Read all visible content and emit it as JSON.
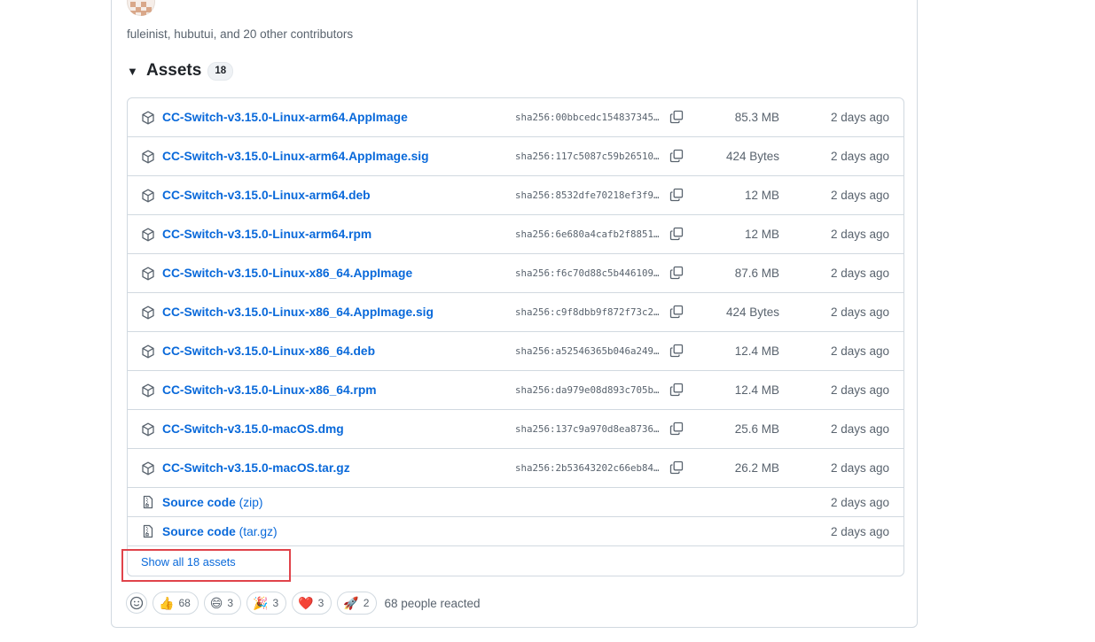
{
  "release": {
    "contributors_text": "fuleinist, hubutui, and 20 other contributors"
  },
  "assets": {
    "title": "Assets",
    "count": "18",
    "files": [
      {
        "name": "CC-Switch-v3.15.0-Linux-arm64.AppImage",
        "sha": "sha256:00bbcedc154837345…",
        "size": "85.3 MB",
        "date": "2 days ago"
      },
      {
        "name": "CC-Switch-v3.15.0-Linux-arm64.AppImage.sig",
        "sha": "sha256:117c5087c59b26510…",
        "size": "424 Bytes",
        "date": "2 days ago"
      },
      {
        "name": "CC-Switch-v3.15.0-Linux-arm64.deb",
        "sha": "sha256:8532dfe70218ef3f9…",
        "size": "12 MB",
        "date": "2 days ago"
      },
      {
        "name": "CC-Switch-v3.15.0-Linux-arm64.rpm",
        "sha": "sha256:6e680a4cafb2f8851…",
        "size": "12 MB",
        "date": "2 days ago"
      },
      {
        "name": "CC-Switch-v3.15.0-Linux-x86_64.AppImage",
        "sha": "sha256:f6c70d88c5b446109…",
        "size": "87.6 MB",
        "date": "2 days ago"
      },
      {
        "name": "CC-Switch-v3.15.0-Linux-x86_64.AppImage.sig",
        "sha": "sha256:c9f8dbb9f872f73c2…",
        "size": "424 Bytes",
        "date": "2 days ago"
      },
      {
        "name": "CC-Switch-v3.15.0-Linux-x86_64.deb",
        "sha": "sha256:a52546365b046a249…",
        "size": "12.4 MB",
        "date": "2 days ago"
      },
      {
        "name": "CC-Switch-v3.15.0-Linux-x86_64.rpm",
        "sha": "sha256:da979e08d893c705b…",
        "size": "12.4 MB",
        "date": "2 days ago"
      },
      {
        "name": "CC-Switch-v3.15.0-macOS.dmg",
        "sha": "sha256:137c9a970d8ea8736…",
        "size": "25.6 MB",
        "date": "2 days ago"
      },
      {
        "name": "CC-Switch-v3.15.0-macOS.tar.gz",
        "sha": "sha256:2b53643202c66eb84…",
        "size": "26.2 MB",
        "date": "2 days ago"
      }
    ],
    "source": [
      {
        "label": "Source code",
        "suffix": "(zip)",
        "date": "2 days ago"
      },
      {
        "label": "Source code",
        "suffix": "(tar.gz)",
        "date": "2 days ago"
      }
    ],
    "show_all": "Show all 18 assets"
  },
  "reactions": {
    "items": [
      {
        "icon": "thumbs-up-icon",
        "emoji": "👍",
        "count": "68"
      },
      {
        "icon": "laugh-icon",
        "emoji": "😄",
        "count": "3"
      },
      {
        "icon": "tada-icon",
        "emoji": "🎉",
        "count": "3"
      },
      {
        "icon": "heart-icon",
        "emoji": "❤️",
        "count": "3"
      },
      {
        "icon": "rocket-icon",
        "emoji": "🚀",
        "count": "2"
      }
    ],
    "summary": "68 people reacted"
  },
  "colors": {
    "link": "#0969da",
    "muted": "#59636e",
    "border": "#d1d9e0",
    "highlight": "#e0434a"
  }
}
